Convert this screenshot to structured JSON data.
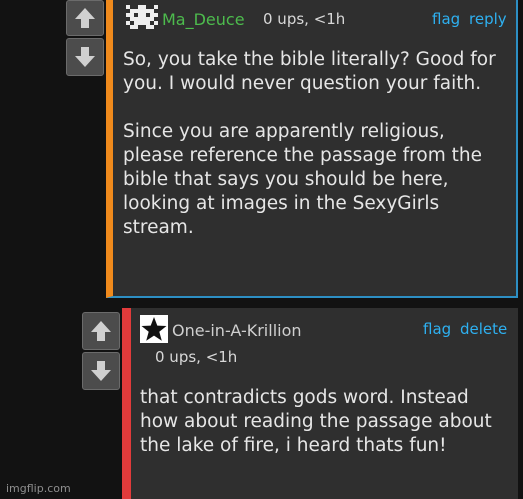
{
  "comment1": {
    "username": "Ma_Deuce",
    "meta": "0 ups, <1h",
    "flag_label": "flag",
    "reply_label": "reply",
    "paragraph1": "So, you take the bible literally? Good for you. I would never question your faith.",
    "paragraph2": "Since you are apparently religious, please reference the passage from the bible that says you should be here, looking at images in the SexyGirls stream.",
    "username_color": "#4dbb4d",
    "bar_color": "#f08a1c"
  },
  "comment2": {
    "username": "One-in-A-Krillion",
    "meta": "0 ups, <1h",
    "flag_label": "flag",
    "delete_label": "delete",
    "paragraph1": "that contradicts gods word. Instead how about reading the passage about the lake of fire, i heard thats fun!",
    "username_color": "#cfcfcf",
    "bar_color": "#e23b3b"
  },
  "icons": {
    "upvote": "arrow-up-icon",
    "downvote": "arrow-down-icon",
    "avatar1": "pixel-avatar-icon",
    "avatar2": "star-icon"
  },
  "watermark": "imgflip.com",
  "accent_color": "#2eb0f0"
}
